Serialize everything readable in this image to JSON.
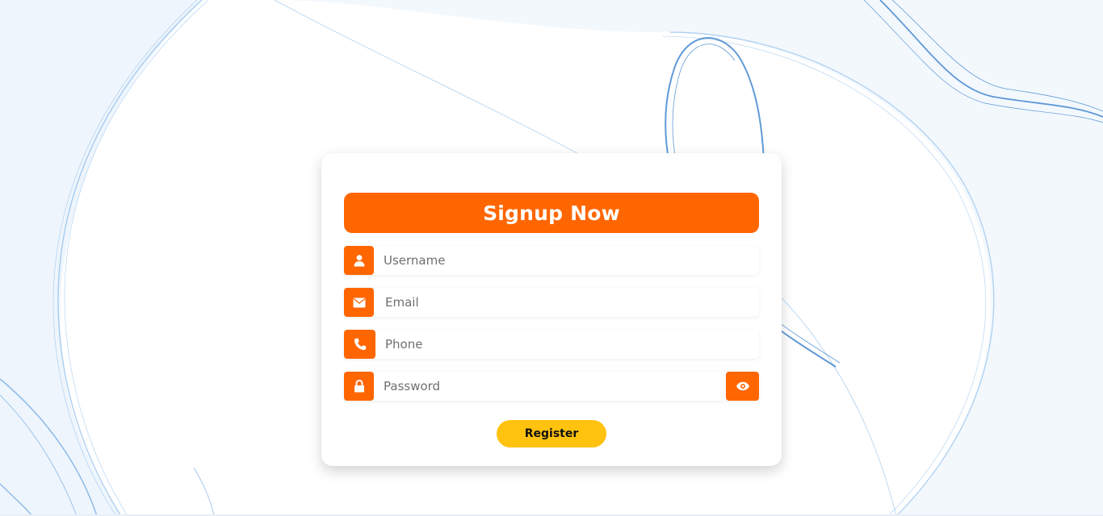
{
  "form": {
    "title": "Signup Now",
    "fields": [
      {
        "name": "username",
        "placeholder": "Username",
        "icon": "user-icon",
        "value": ""
      },
      {
        "name": "email",
        "placeholder": "Email",
        "icon": "envelope-icon",
        "value": ""
      },
      {
        "name": "phone",
        "placeholder": "Phone",
        "icon": "phone-icon",
        "value": ""
      },
      {
        "name": "password",
        "placeholder": "Password",
        "icon": "lock-icon",
        "value": ""
      }
    ],
    "toggle_password_icon": "eye-icon",
    "register_label": "Register"
  },
  "colors": {
    "accent": "#ff6600",
    "button": "#ffc20e",
    "background_lines": "#2a7fd4"
  }
}
